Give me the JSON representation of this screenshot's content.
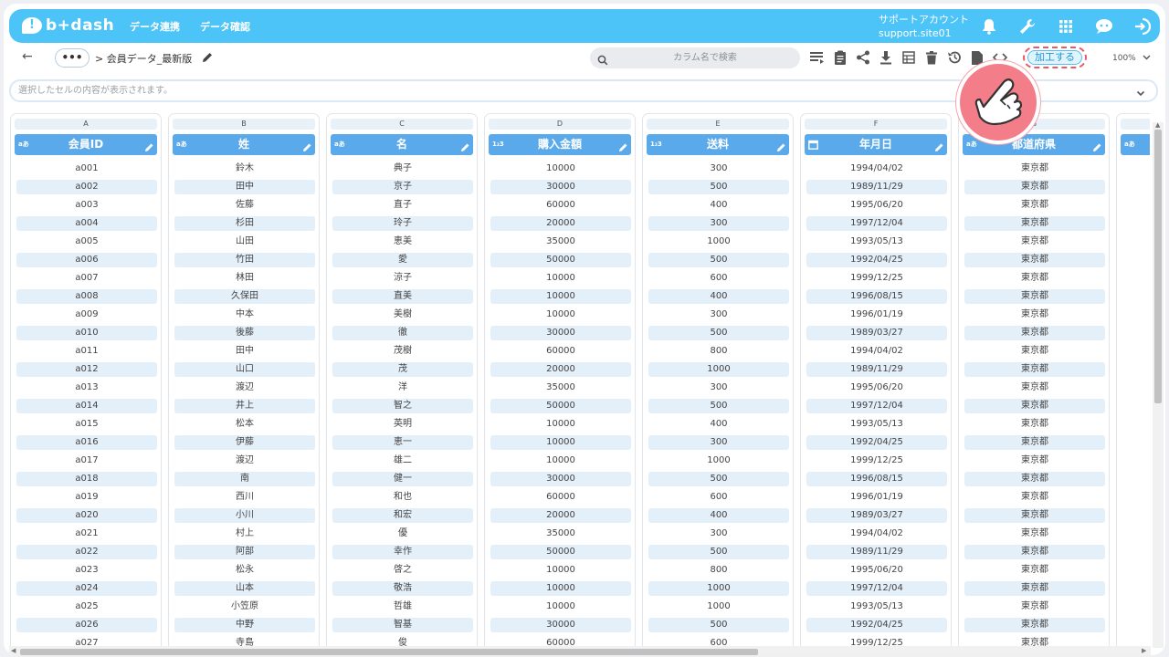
{
  "app": {
    "logo_text": "b+dash"
  },
  "nav": {
    "items": [
      "データ連携",
      "データ確認"
    ]
  },
  "account": {
    "name": "サポートアカウント",
    "site": "support.site01"
  },
  "toolbar": {
    "more_label": "•••",
    "breadcrumb": "> 会員データ_最新版",
    "search_placeholder": "カラム名で検索",
    "process_label": "加工する",
    "zoom": "100%"
  },
  "cell_display": {
    "placeholder": "選択したセルの内容が表示されます。"
  },
  "columns": [
    {
      "letter": "A",
      "name": "会員ID",
      "type": "aあ"
    },
    {
      "letter": "B",
      "name": "姓",
      "type": "aあ"
    },
    {
      "letter": "C",
      "name": "名",
      "type": "aあ"
    },
    {
      "letter": "D",
      "name": "購入金額",
      "type": "1₂3"
    },
    {
      "letter": "E",
      "name": "送料",
      "type": "1₂3"
    },
    {
      "letter": "F",
      "name": "年月日",
      "type": "calendar"
    },
    {
      "letter": "G",
      "name": "都道府県",
      "type": "aあ"
    },
    {
      "letter": "",
      "name": "",
      "type": "aあ"
    }
  ],
  "rows": [
    [
      "a001",
      "鈴木",
      "典子",
      "10000",
      "300",
      "1994/04/02",
      "東京都"
    ],
    [
      "a002",
      "田中",
      "京子",
      "30000",
      "500",
      "1989/11/29",
      "東京都"
    ],
    [
      "a003",
      "佐藤",
      "直子",
      "60000",
      "400",
      "1995/06/20",
      "東京都"
    ],
    [
      "a004",
      "杉田",
      "玲子",
      "20000",
      "300",
      "1997/12/04",
      "東京都"
    ],
    [
      "a005",
      "山田",
      "恵美",
      "35000",
      "1000",
      "1993/05/13",
      "東京都"
    ],
    [
      "a006",
      "竹田",
      "愛",
      "50000",
      "500",
      "1992/04/25",
      "東京都"
    ],
    [
      "a007",
      "林田",
      "涼子",
      "10000",
      "600",
      "1999/12/25",
      "東京都"
    ],
    [
      "a008",
      "久保田",
      "直美",
      "10000",
      "400",
      "1996/08/15",
      "東京都"
    ],
    [
      "a009",
      "中本",
      "美樹",
      "10000",
      "300",
      "1996/01/19",
      "東京都"
    ],
    [
      "a010",
      "後藤",
      "徹",
      "30000",
      "500",
      "1989/03/27",
      "東京都"
    ],
    [
      "a011",
      "田中",
      "茂樹",
      "60000",
      "800",
      "1994/04/02",
      "東京都"
    ],
    [
      "a012",
      "山口",
      "茂",
      "20000",
      "1000",
      "1989/11/29",
      "東京都"
    ],
    [
      "a013",
      "渡辺",
      "洋",
      "35000",
      "300",
      "1995/06/20",
      "東京都"
    ],
    [
      "a014",
      "井上",
      "智之",
      "50000",
      "500",
      "1997/12/04",
      "東京都"
    ],
    [
      "a015",
      "松本",
      "英明",
      "10000",
      "400",
      "1993/05/13",
      "東京都"
    ],
    [
      "a016",
      "伊藤",
      "恵一",
      "10000",
      "300",
      "1992/04/25",
      "東京都"
    ],
    [
      "a017",
      "渡辺",
      "雄二",
      "10000",
      "1000",
      "1999/12/25",
      "東京都"
    ],
    [
      "a018",
      "南",
      "健一",
      "30000",
      "500",
      "1996/08/15",
      "東京都"
    ],
    [
      "a019",
      "西川",
      "和也",
      "60000",
      "600",
      "1996/01/19",
      "東京都"
    ],
    [
      "a020",
      "小川",
      "和宏",
      "20000",
      "400",
      "1989/03/27",
      "東京都"
    ],
    [
      "a021",
      "村上",
      "優",
      "35000",
      "300",
      "1994/04/02",
      "東京都"
    ],
    [
      "a022",
      "阿部",
      "幸作",
      "50000",
      "500",
      "1989/11/29",
      "東京都"
    ],
    [
      "a023",
      "松永",
      "啓之",
      "10000",
      "800",
      "1995/06/20",
      "東京都"
    ],
    [
      "a024",
      "山本",
      "敬浩",
      "10000",
      "1000",
      "1997/12/04",
      "東京都"
    ],
    [
      "a025",
      "小笠原",
      "哲雄",
      "10000",
      "1000",
      "1993/05/13",
      "東京都"
    ],
    [
      "a026",
      "中野",
      "智基",
      "30000",
      "500",
      "1992/04/25",
      "東京都"
    ],
    [
      "a027",
      "寺島",
      "俊",
      "60000",
      "600",
      "1999/12/25",
      "東京都"
    ]
  ],
  "colors": {
    "brand": "#4cc4f7",
    "header": "#5aaaeb",
    "highlight": "#e85a6a"
  }
}
